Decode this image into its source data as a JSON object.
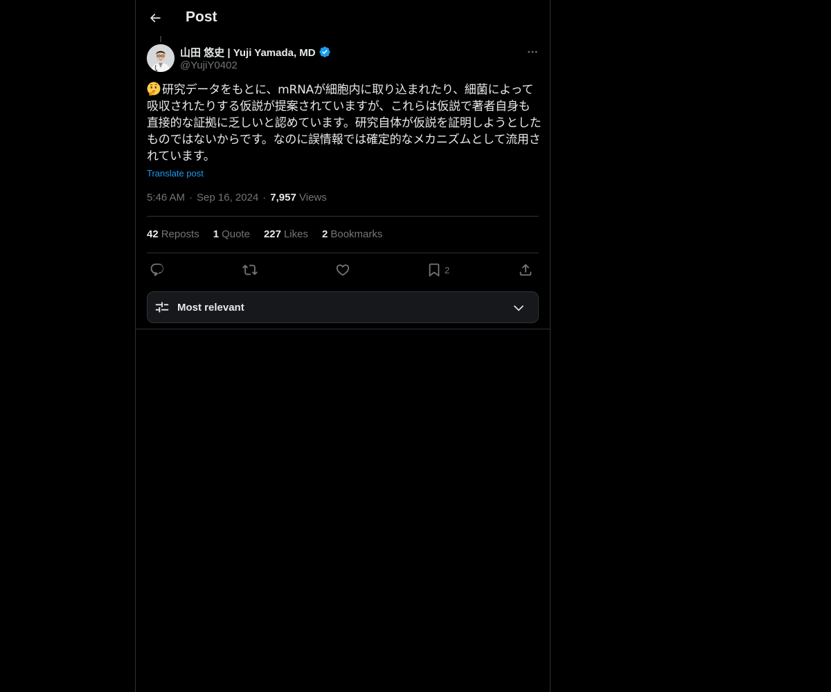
{
  "header": {
    "title": "Post"
  },
  "author": {
    "display_name": "山田 悠史 | Yuji Yamada, MD",
    "handle": "@YujiY0402",
    "verified": true
  },
  "post": {
    "emoji": "thinking-face",
    "text": "研究データをもとに、mRNAが細胞内に取り込まれたり、細菌によって吸収されたりする仮説が提案されていますが、これらは仮説で著者自身も直接的な証拠に乏しいと認めています。研究自体が仮説を証明しようとしたものではないからです。なのに誤情報では確定的なメカニズムとして流用されています。",
    "translate_label": "Translate post",
    "time": "5:46 AM",
    "date": "Sep 16, 2024",
    "views_count": "7,957",
    "views_label": "Views",
    "separator": "·"
  },
  "stats": {
    "reposts": {
      "count": "42",
      "label": "Reposts"
    },
    "quotes": {
      "count": "1",
      "label": "Quote"
    },
    "likes": {
      "count": "227",
      "label": "Likes"
    },
    "bookmarks": {
      "count": "2",
      "label": "Bookmarks"
    }
  },
  "actions": {
    "bookmark_count": "2"
  },
  "sort": {
    "label": "Most relevant"
  },
  "colors": {
    "background": "#000000",
    "text": "#e7e9ea",
    "muted": "#71767b",
    "accent": "#1d9bf0",
    "border": "#2f3336"
  }
}
